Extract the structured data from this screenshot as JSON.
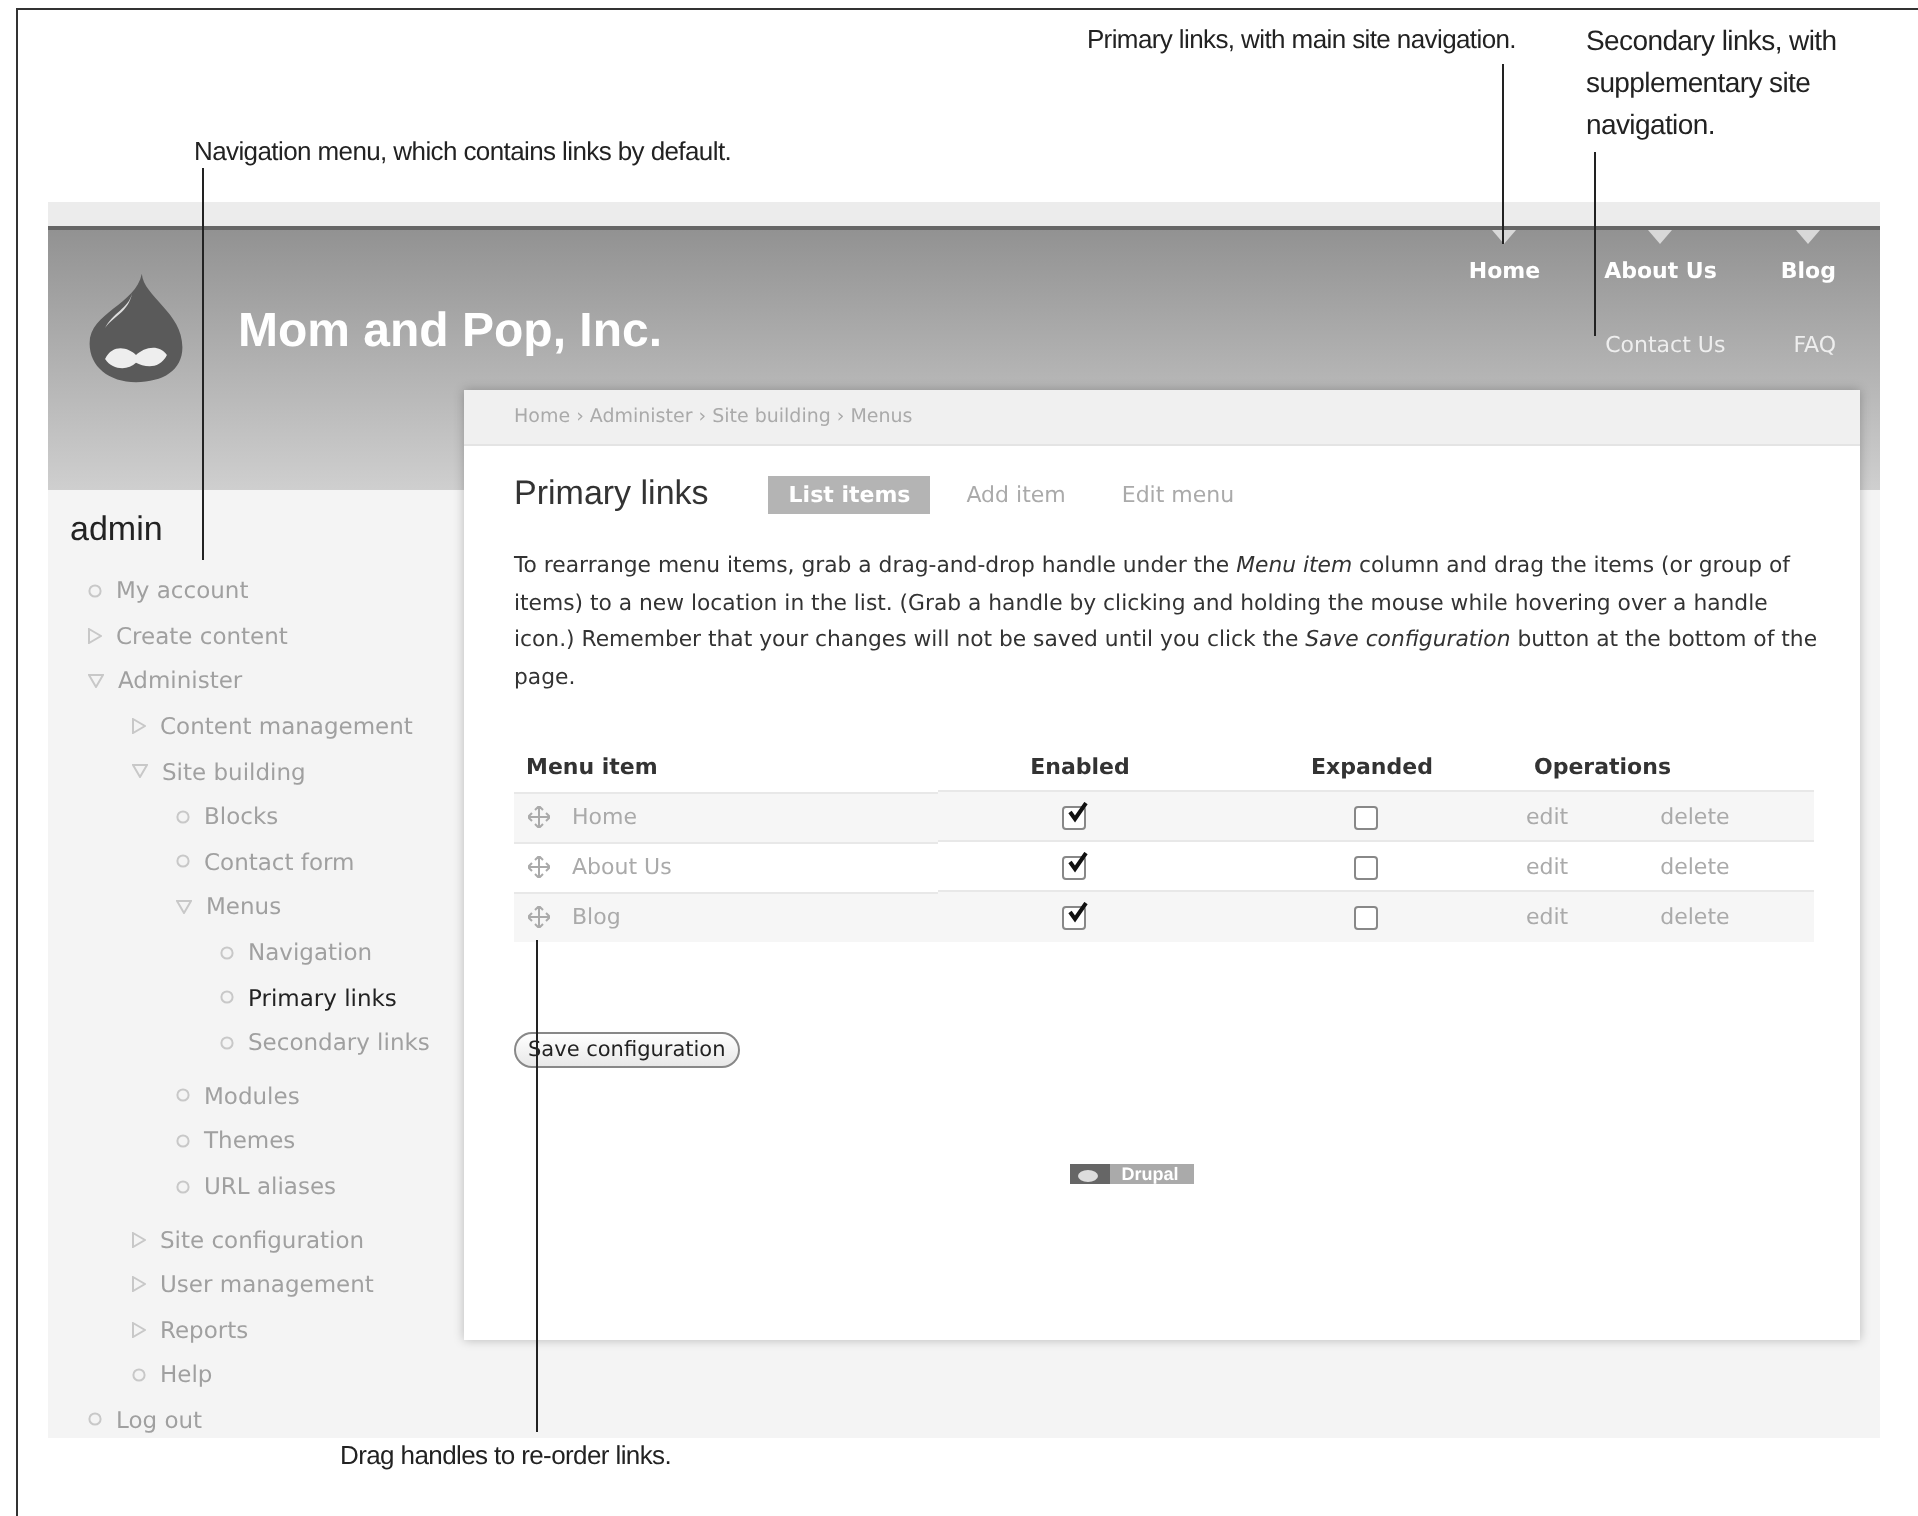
{
  "annotations": [
    {
      "text": "Primary links, with main site navigation."
    },
    {
      "text": "Secondary links, with supplementary site navigation."
    },
    {
      "text": "Navigation menu, which contains links by default."
    },
    {
      "text": "Drag handles to re-order links."
    }
  ],
  "site": {
    "name": "Mom and Pop, Inc.",
    "primary_links": [
      "Home",
      "About Us",
      "Blog"
    ],
    "secondary_links": [
      "Contact Us",
      "FAQ"
    ]
  },
  "sidebar": {
    "title": "admin",
    "items": [
      {
        "label": "My account",
        "kind": "leaf",
        "selected": false
      },
      {
        "label": "Create content",
        "kind": "collapsed",
        "selected": false
      },
      {
        "label": "Administer",
        "kind": "expanded",
        "selected": false,
        "children": [
          {
            "label": "Content management",
            "kind": "collapsed",
            "selected": false
          },
          {
            "label": "Site building",
            "kind": "expanded",
            "selected": false,
            "children": [
              {
                "label": "Blocks",
                "kind": "leaf",
                "selected": false
              },
              {
                "label": "Contact form",
                "kind": "leaf",
                "selected": false
              },
              {
                "label": "Menus",
                "kind": "expanded",
                "selected": false,
                "children": [
                  {
                    "label": "Navigation",
                    "kind": "leaf",
                    "selected": false
                  },
                  {
                    "label": "Primary links",
                    "kind": "leaf",
                    "selected": true
                  },
                  {
                    "label": "Secondary links",
                    "kind": "leaf",
                    "selected": false
                  }
                ]
              },
              {
                "label": "Modules",
                "kind": "leaf",
                "selected": false
              },
              {
                "label": "Themes",
                "kind": "leaf",
                "selected": false
              },
              {
                "label": "URL aliases",
                "kind": "leaf",
                "selected": false
              }
            ]
          },
          {
            "label": "Site configuration",
            "kind": "collapsed",
            "selected": false
          },
          {
            "label": "User management",
            "kind": "collapsed",
            "selected": false
          },
          {
            "label": "Reports",
            "kind": "collapsed",
            "selected": false
          },
          {
            "label": "Help",
            "kind": "leaf",
            "selected": false
          }
        ]
      },
      {
        "label": "Log out",
        "kind": "leaf",
        "selected": false
      }
    ]
  },
  "breadcrumb": "Home › Administer › Site building › Menus",
  "page_title": "Primary links",
  "tabs": [
    {
      "label": "List items",
      "selected": true
    },
    {
      "label": "Add item",
      "selected": false
    },
    {
      "label": "Edit menu",
      "selected": false
    }
  ],
  "description": "To rearrange menu items, grab a drag-and-drop handle under the *Menu item* column and drag the items (or group of items) to a new location in the list. (Grab a handle by clicking and holding the mouse while hovering over a handle icon.) Remember that your changes will not be saved until you click the *Save configuration* button at the bottom of the page.",
  "table": {
    "columns": [
      "Menu item",
      "Enabled",
      "Expanded",
      "Operations"
    ],
    "rows": [
      {
        "name": "Home",
        "enabled": true,
        "expanded": false,
        "edit": "edit",
        "delete": "delete"
      },
      {
        "name": "About Us",
        "enabled": true,
        "expanded": false,
        "edit": "edit",
        "delete": "delete"
      },
      {
        "name": "Blog",
        "enabled": true,
        "expanded": false,
        "edit": "edit",
        "delete": "delete"
      }
    ]
  },
  "save_button": "Save configuration",
  "footer_badge": "Drupal"
}
